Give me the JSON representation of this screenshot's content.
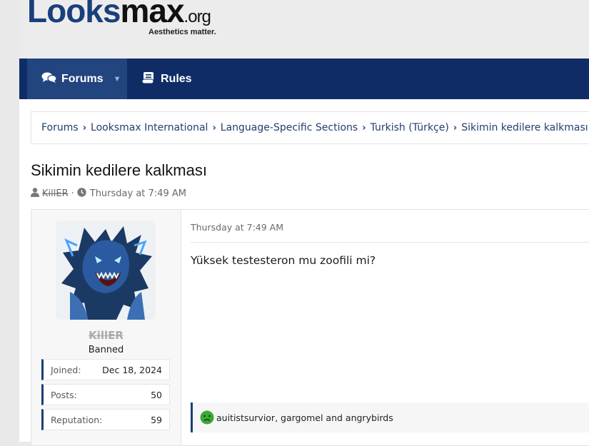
{
  "site": {
    "logo_looks": "Looks",
    "logo_max": "max",
    "logo_org": ".org",
    "tagline": "Aesthetics matter."
  },
  "nav": {
    "forums": "Forums",
    "rules": "Rules"
  },
  "breadcrumb": [
    "Forums",
    "Looksmax International",
    "Language-Specific Sections",
    "Turkish (Türkçe)",
    "Sikimin kedilere kalkması"
  ],
  "thread": {
    "title": "Sikimin kedilere kalkması",
    "author": "KillER",
    "separator": "·",
    "date": "Thursday at 7:49 AM"
  },
  "post": {
    "username": "KillER",
    "user_title": "Banned",
    "stats": [
      {
        "label": "Joined:",
        "value": "Dec 18, 2024"
      },
      {
        "label": "Posts:",
        "value": "50"
      },
      {
        "label": "Reputation:",
        "value": "59"
      }
    ],
    "date": "Thursday at 7:49 AM",
    "body": "Yüksek testesteron mu zoofili mi?",
    "reactions_text": "auitistsurvior, gargomel and angrybirds"
  },
  "colors": {
    "navbar": "#0f2c66",
    "nav_active": "#22447f",
    "accent": "#1c3e76",
    "reaction_emoji": "#3aa935"
  }
}
